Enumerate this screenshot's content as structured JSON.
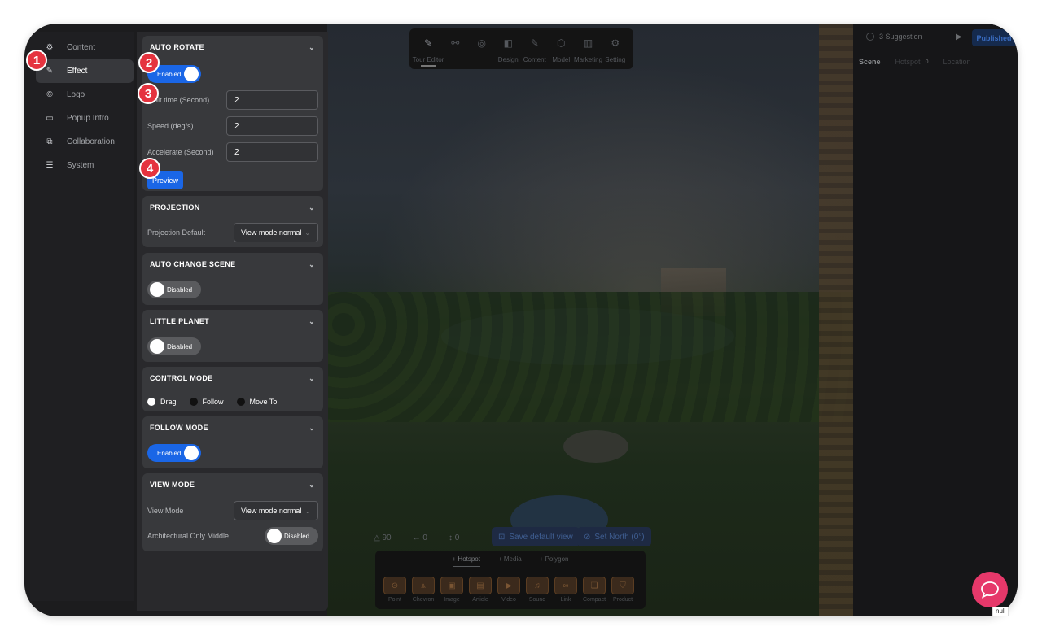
{
  "nav": {
    "items": [
      {
        "label": "Content",
        "icon": "gear-icon"
      },
      {
        "label": "Effect",
        "icon": "pencil-icon"
      },
      {
        "label": "Logo",
        "icon": "copyright-icon"
      },
      {
        "label": "Popup Intro",
        "icon": "window-icon"
      },
      {
        "label": "Collaboration",
        "icon": "chat-bubbles-icon"
      },
      {
        "label": "System",
        "icon": "server-icon"
      }
    ],
    "active": "Effect"
  },
  "panel": {
    "auto_rotate": {
      "title": "AUTO ROTATE",
      "toggle": "Enabled",
      "wait_label": "Wait time (Second)",
      "wait_value": "2",
      "speed_label": "Speed (deg/s)",
      "speed_value": "2",
      "accel_label": "Accelerate (Second)",
      "accel_value": "2",
      "preview": "Preview"
    },
    "projection": {
      "title": "PROJECTION",
      "default_label": "Projection Default",
      "default_value": "View mode normal"
    },
    "auto_change_scene": {
      "title": "AUTO CHANGE SCENE",
      "toggle": "Disabled"
    },
    "little_planet": {
      "title": "LITTLE PLANET",
      "toggle": "Disabled"
    },
    "control_mode": {
      "title": "CONTROL MODE",
      "options": [
        "Drag",
        "Follow",
        "Move To"
      ],
      "selected": "Drag"
    },
    "follow_mode": {
      "title": "FOLLOW MODE",
      "toggle": "Enabled"
    },
    "view_mode": {
      "title": "VIEW MODE",
      "mode_label": "View Mode",
      "mode_value": "View mode normal",
      "arch_label": "Architectural Only Middle",
      "arch_toggle": "Disabled"
    }
  },
  "markers": [
    "1",
    "2",
    "3",
    "4"
  ],
  "top_toolbar": {
    "items": [
      {
        "label": "Tour Editor",
        "icon": "pencil-icon"
      },
      {
        "label": "",
        "icon": "nodes-icon"
      },
      {
        "label": "",
        "icon": "target-icon"
      },
      {
        "label": "Design",
        "icon": "design-icon"
      },
      {
        "label": "Content",
        "icon": "pencil-icon"
      },
      {
        "label": "Model",
        "icon": "cube-icon"
      },
      {
        "label": "Marketing",
        "icon": "chart-icon"
      },
      {
        "label": "Setting",
        "icon": "gear-icon"
      }
    ]
  },
  "scene_controls": {
    "fov": "90",
    "h": "0",
    "v": "0",
    "save_default_view": "Save default view",
    "set_north": "Set North (0°)"
  },
  "hotspot_bar": {
    "tabs": [
      "+ Hotspot",
      "+ Media",
      "+ Polygon"
    ],
    "items": [
      "Point",
      "Chevron",
      "Image",
      "Article",
      "Video",
      "Sound",
      "Link",
      "Compact",
      "Product"
    ]
  },
  "right_panel": {
    "suggestion": "3 Suggestion",
    "published": "Published",
    "tabs": [
      "Scene",
      "Hotspot",
      "Location"
    ],
    "hotspot_count": "0"
  },
  "null_tag": "null",
  "colors": {
    "accent": "#1a66e6",
    "marker": "#e5333f",
    "chat": "#e6386a"
  }
}
